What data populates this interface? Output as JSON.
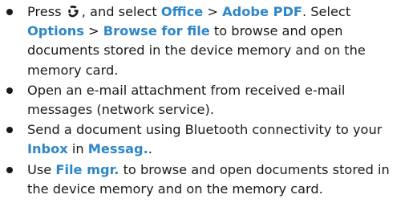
{
  "items": [
    {
      "before_icon": "Press ",
      "icon": "menu-key-icon",
      "t1": ", and select ",
      "kw1": "Office",
      "t2": " > ",
      "kw2": "Adobe PDF",
      "t3": ". Select ",
      "kw3": "Options",
      "t4": " > ",
      "kw4": "Browse for file",
      "t5": " to browse and open documents stored in the device memory and on the memory card."
    },
    {
      "text": "Open an e-mail attachment from received e-mail messages (network service)."
    },
    {
      "t1": "Send a document using Bluetooth connectivity to your ",
      "kw1": "Inbox",
      "t2": " in ",
      "kw2": "Messag.",
      "t3": "."
    },
    {
      "t1": "Use ",
      "kw1": "File mgr.",
      "t2": " to browse and open documents stored in the device memory and on the memory card."
    }
  ],
  "colors": {
    "keyword": "#2d86c7",
    "text": "#1a1a1a"
  }
}
